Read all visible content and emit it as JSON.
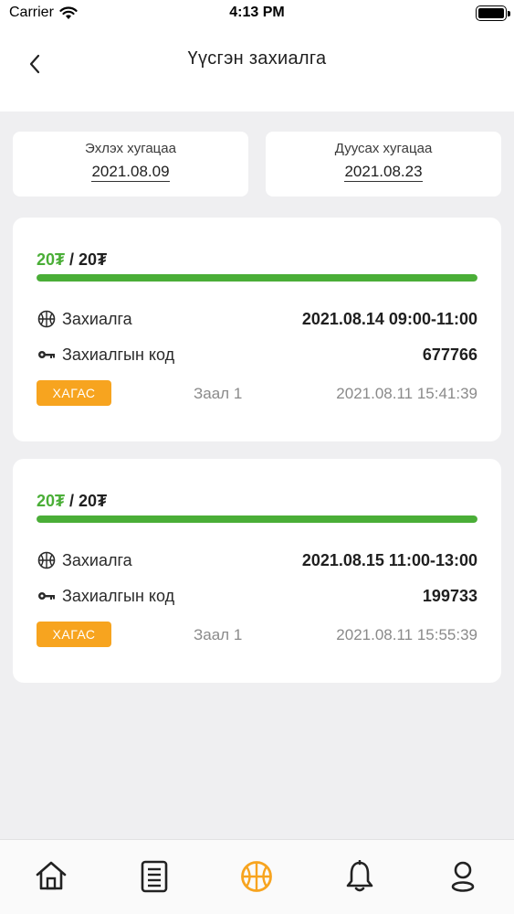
{
  "status_bar": {
    "carrier": "Carrier",
    "time": "4:13 PM"
  },
  "header": {
    "title": "Үүсгэн захиалга",
    "back_icon": "chevron-left-icon"
  },
  "date_range": {
    "start": {
      "label": "Эхлэх хугацаа",
      "value": "2021.08.09"
    },
    "end": {
      "label": "Дуусах хугацаа",
      "value": "2021.08.23"
    }
  },
  "orders": [
    {
      "paid": "20₮",
      "separator": " / ",
      "total": "20₮",
      "progress_percent": 100,
      "booking_label": "Захиалга",
      "booking_value": "2021.08.14 09:00-11:00",
      "code_label": "Захиалгын код",
      "code_value": "677766",
      "badge": "ХАГАС",
      "hall": "Заал 1",
      "created": "2021.08.11 15:41:39"
    },
    {
      "paid": "20₮",
      "separator": " / ",
      "total": "20₮",
      "progress_percent": 100,
      "booking_label": "Захиалга",
      "booking_value": "2021.08.15 11:00-13:00",
      "code_label": "Захиалгын код",
      "code_value": "199733",
      "badge": "ХАГАС",
      "hall": "Заал 1",
      "created": "2021.08.11 15:55:39"
    }
  ],
  "bottom_nav": {
    "items": [
      "home-icon",
      "list-icon",
      "basketball-icon",
      "bell-icon",
      "profile-icon"
    ],
    "active": "basketball-icon"
  },
  "colors": {
    "accent_green": "#4aae37",
    "badge_orange": "#f7a41f",
    "active_nav": "#f7a41f"
  }
}
